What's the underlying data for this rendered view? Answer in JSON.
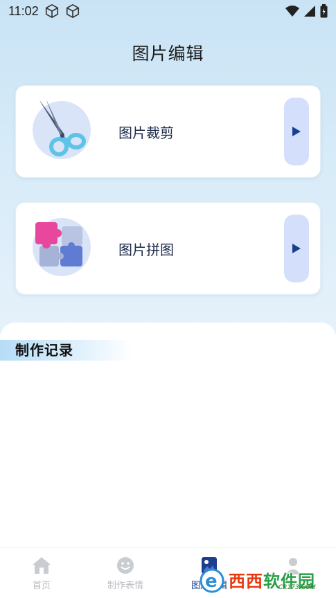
{
  "status_bar": {
    "time": "11:02"
  },
  "page_title": "图片编辑",
  "cards": [
    {
      "label": "图片裁剪",
      "icon": "scissors-icon"
    },
    {
      "label": "图片拼图",
      "icon": "puzzle-icon"
    }
  ],
  "section": {
    "title": "制作记录"
  },
  "bottom_nav": [
    {
      "label": "首页",
      "icon": "home-icon",
      "active": false
    },
    {
      "label": "制作表情",
      "icon": "smile-icon",
      "active": false
    },
    {
      "label": "图片编辑",
      "icon": "image-edit-icon",
      "active": true
    },
    {
      "label": "",
      "icon": "user-icon",
      "active": false
    }
  ],
  "watermark": {
    "text_red": "西西",
    "text_green": "软件园",
    "url": "CR173.COM"
  },
  "colors": {
    "accent": "#1b3f8f",
    "card_button": "#d4e0fb",
    "inactive_nav": "#b9bcc2"
  }
}
